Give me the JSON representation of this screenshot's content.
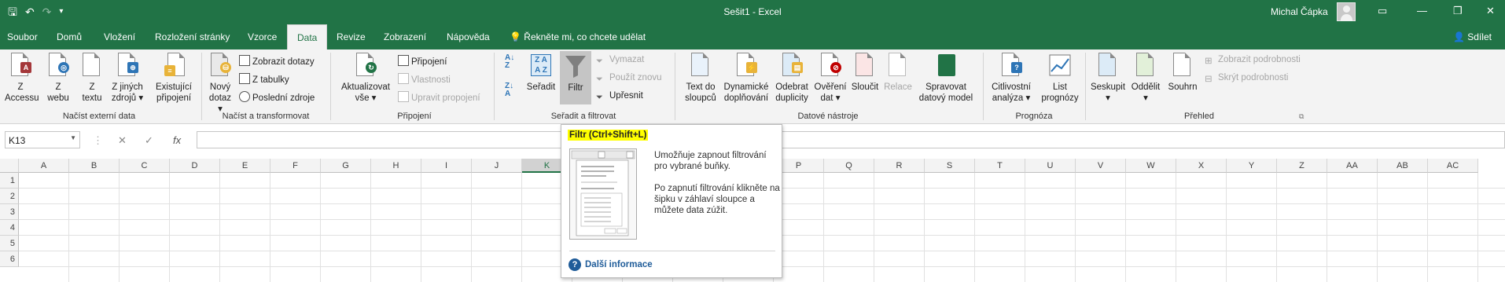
{
  "window": {
    "title": "Sešit1  -  Excel",
    "user": "Michal Čápka",
    "share": "Sdílet"
  },
  "tabs": [
    "Soubor",
    "Domů",
    "Vložení",
    "Rozložení stránky",
    "Vzorce",
    "Data",
    "Revize",
    "Zobrazení",
    "Nápověda"
  ],
  "active_tab": "Data",
  "tell_me": "Řekněte mi, co chcete udělat",
  "groups": {
    "external": {
      "label": "Načíst externí data",
      "buttons": [
        [
          "Z",
          "Accessu"
        ],
        [
          "Z",
          "webu"
        ],
        [
          "Z",
          "textu"
        ],
        [
          "Z jiných",
          "zdrojů ▾"
        ],
        [
          "Existující",
          "připojení"
        ]
      ]
    },
    "transform": {
      "label": "Načíst a transformovat",
      "new_query": [
        "Nový",
        "dotaz ▾"
      ],
      "small": [
        "Zobrazit dotazy",
        "Z tabulky",
        "Poslední zdroje"
      ]
    },
    "connections": {
      "label": "Připojení",
      "refresh": [
        "Aktualizovat",
        "vše ▾"
      ],
      "small": [
        "Připojení",
        "Vlastnosti",
        "Upravit propojení"
      ]
    },
    "sort": {
      "label": "Seřadit a filtrovat",
      "sort": "Seřadit",
      "filter": "Filtr",
      "small": [
        "Vymazat",
        "Použít znovu",
        "Upřesnit"
      ]
    },
    "tools": {
      "label": "Datové nástroje",
      "buttons": [
        [
          "Text do",
          "sloupců"
        ],
        [
          "Dynamické",
          "doplňování"
        ],
        [
          "Odebrat",
          "duplicity"
        ],
        [
          "Ověření",
          "dat ▾"
        ],
        [
          "Sloučit",
          ""
        ],
        [
          "Relace",
          ""
        ],
        [
          "Spravovat",
          "datový model"
        ]
      ]
    },
    "forecast": {
      "label": "Prognóza",
      "buttons": [
        [
          "Citlivostní",
          "analýza ▾"
        ],
        [
          "List",
          "prognózy"
        ]
      ]
    },
    "outline": {
      "label": "Přehled",
      "buttons": [
        [
          "Seskupit",
          "▾"
        ],
        [
          "Oddělit",
          "▾"
        ],
        [
          "Souhrn",
          ""
        ]
      ],
      "small": [
        "Zobrazit podrobnosti",
        "Skrýt podrobnosti"
      ]
    }
  },
  "name_box": "K13",
  "fx_label": "fx",
  "columns": [
    "A",
    "B",
    "C",
    "D",
    "E",
    "F",
    "G",
    "H",
    "I",
    "J",
    "K",
    "L",
    "M",
    "N",
    "O",
    "P",
    "Q",
    "R",
    "S",
    "T",
    "U",
    "V",
    "W",
    "X",
    "Y",
    "Z",
    "AA",
    "AB",
    "AC"
  ],
  "rows": [
    "1",
    "2",
    "3",
    "4",
    "5",
    "6"
  ],
  "tooltip": {
    "title": "Filtr (Ctrl+Shift+L)",
    "p1": "Umožňuje zapnout filtrování pro vybrané buňky.",
    "p2": "Po zapnutí filtrování klikněte na šipku v záhlaví sloupce a můžete data zúžit.",
    "more": "Další informace"
  },
  "colors": {
    "accent": "#217346",
    "highlight": "#ffff00",
    "link": "#1f5c99"
  }
}
